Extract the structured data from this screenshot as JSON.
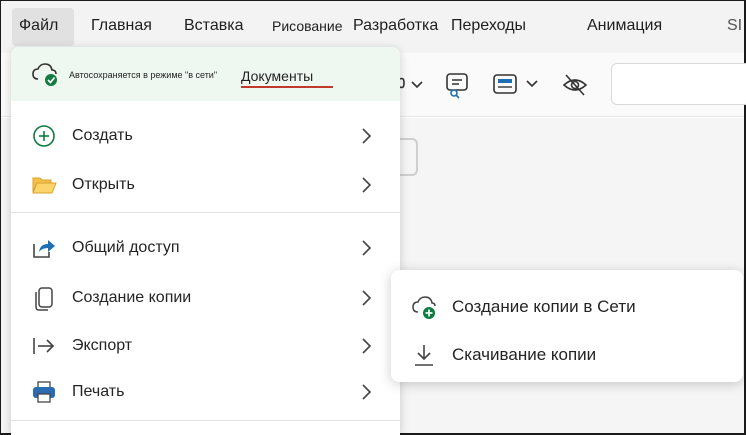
{
  "tabs": [
    {
      "label": "Файл"
    },
    {
      "label": "Главная"
    },
    {
      "label": "Вставка"
    },
    {
      "label": "Рисование"
    },
    {
      "label": "Разработка"
    },
    {
      "label": "Переходы"
    },
    {
      "label": "Анимация"
    },
    {
      "label": "SI"
    }
  ],
  "autosave": {
    "text": "Автосохраняется в режиме \"в сети\"",
    "location": "Документы"
  },
  "file_menu": {
    "items": [
      {
        "label": "Создать",
        "icon": "plus-circle-icon"
      },
      {
        "label": "Открыть",
        "icon": "folder-open-icon"
      },
      {
        "label": "Общий доступ",
        "icon": "share-icon"
      },
      {
        "label": "Создание копии",
        "icon": "copy-icon"
      },
      {
        "label": "Экспорт",
        "icon": "export-arrow-icon"
      },
      {
        "label": "Печать",
        "icon": "printer-icon"
      }
    ]
  },
  "submenu": {
    "items": [
      {
        "label": "Создание копии в Сети",
        "icon": "cloud-add-icon"
      },
      {
        "label": "Скачивание копии",
        "icon": "download-icon"
      }
    ]
  },
  "colors": {
    "accent_green": "#107c41",
    "autosave_bg": "#eef7f0",
    "underline_red": "#c0392b",
    "ribbon_blue": "#1f6fb5"
  }
}
